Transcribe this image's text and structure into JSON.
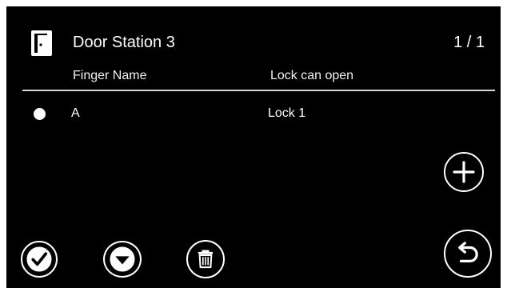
{
  "header": {
    "icon": "door-icon",
    "title": "Door Station 3",
    "page_indicator": "1 / 1"
  },
  "table": {
    "columns": [
      "Finger Name",
      "Lock can open"
    ],
    "rows": [
      {
        "name": "A",
        "lock": "Lock 1",
        "selected": true
      }
    ]
  },
  "buttons": {
    "add": "plus-icon",
    "back": "back-arrow-icon",
    "confirm": "check-icon",
    "next": "chevron-down-icon",
    "delete": "trash-icon"
  },
  "colors": {
    "background": "#000000",
    "foreground": "#ffffff",
    "frame": "#ffffff"
  }
}
